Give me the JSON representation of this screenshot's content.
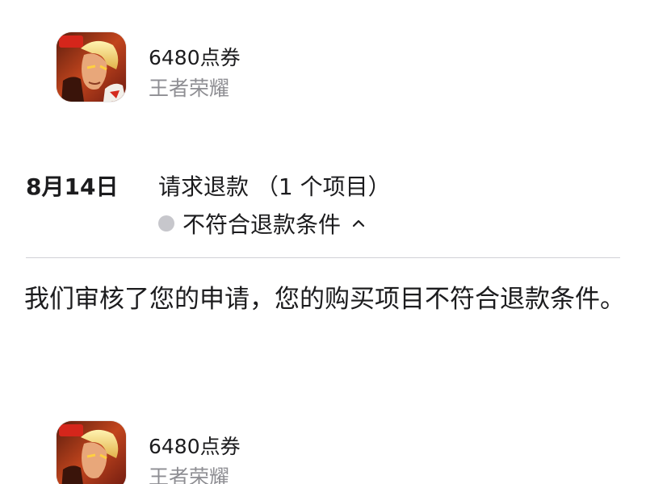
{
  "items": [
    {
      "name": "6480点券",
      "app": "王者荣耀",
      "icon": "honor-of-kings-app-icon",
      "icon_badge": "5v5"
    },
    {
      "name": "6480点券",
      "app": "王者荣耀",
      "icon": "honor-of-kings-app-icon",
      "icon_badge": "5v5"
    }
  ],
  "refund": {
    "date": "8月14日",
    "request": "请求退款 （1 个项目）",
    "status": "不符合退款条件",
    "status_dot_color": "#c7c7cc",
    "expand_icon": "chevron-up-icon"
  },
  "message": "我们审核了您的申请，您的购买项目不符合退款条件。"
}
